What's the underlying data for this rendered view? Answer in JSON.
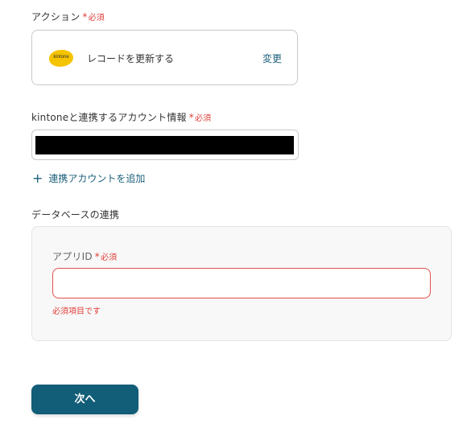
{
  "action": {
    "label": "アクション",
    "required_mark": "*",
    "required_text": "必須",
    "logo_text": "kintone",
    "text": "レコードを更新する",
    "change_label": "変更"
  },
  "account": {
    "label": "kintoneと連携するアカウント情報",
    "required_mark": "*",
    "required_text": "必須",
    "add_icon": "+",
    "add_label": "連携アカウントを追加"
  },
  "database": {
    "label": "データベースの連携",
    "app_id_label": "アプリID",
    "required_mark": "*",
    "required_text": "必須",
    "app_id_value": "",
    "error_text": "必須項目です"
  },
  "footer": {
    "next_label": "次へ"
  },
  "colors": {
    "accent": "#125d77",
    "link": "#1a5f7a",
    "error": "#e0413a",
    "kintone_yellow": "#f5c400"
  }
}
